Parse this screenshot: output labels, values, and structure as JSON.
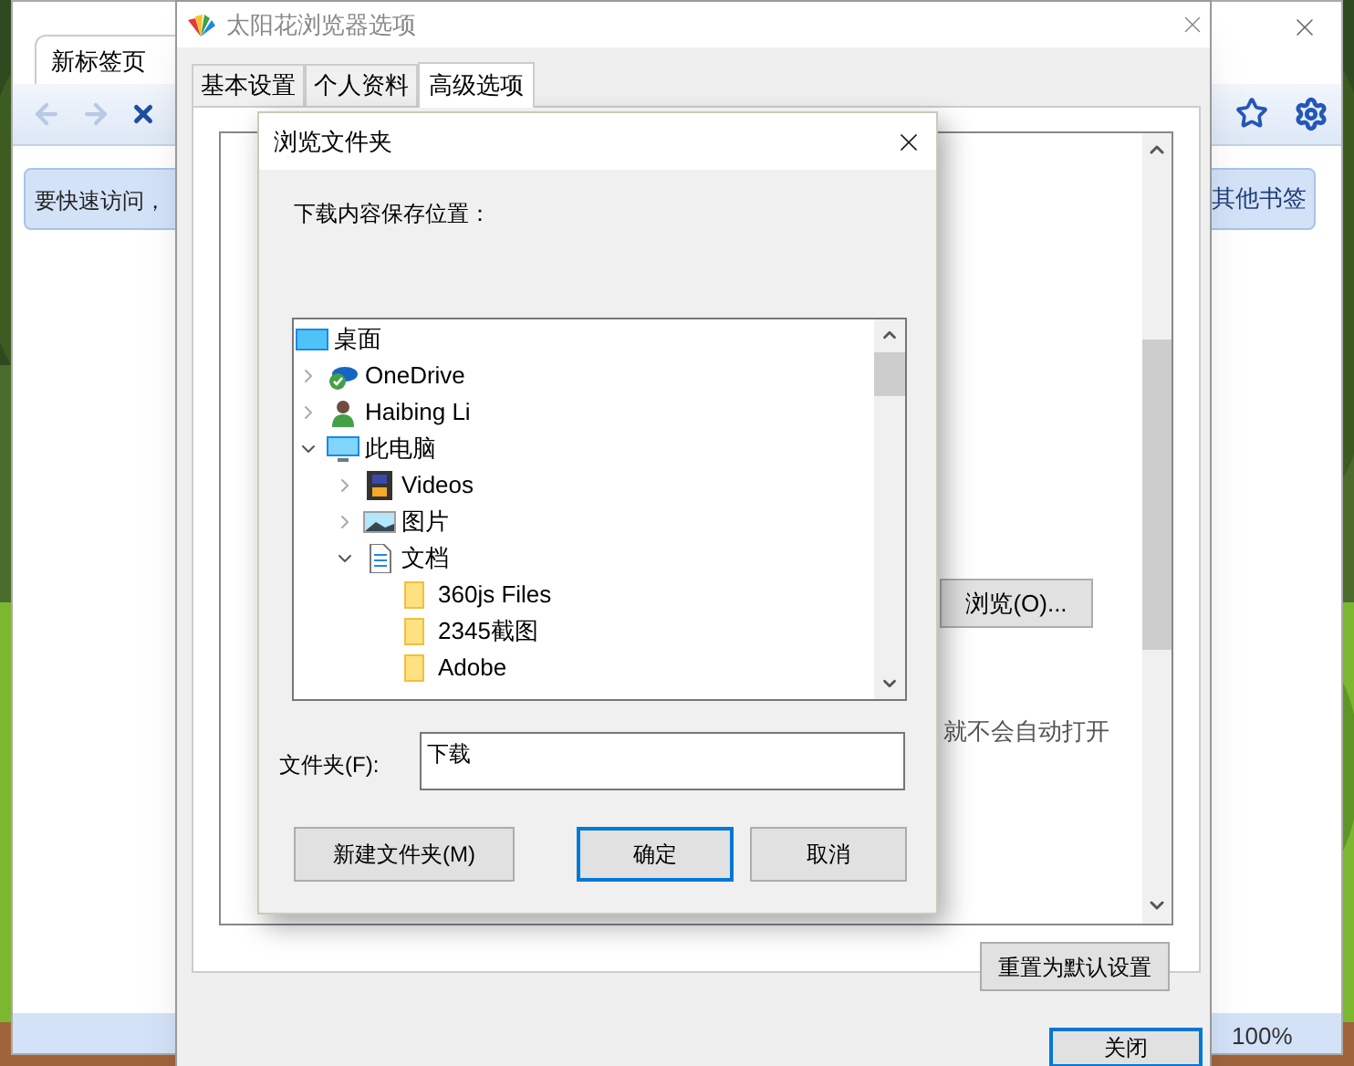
{
  "browser": {
    "tab": "新标签页",
    "bookmark_notice": "要快速访问，",
    "other_bookmarks": "其他书签",
    "zoom": "100%"
  },
  "options_dialog": {
    "title": "太阳花浏览器选项",
    "tabs": [
      {
        "label": "基本设置",
        "selected": false
      },
      {
        "label": "个人资料",
        "selected": false
      },
      {
        "label": "高级选项",
        "selected": true
      }
    ],
    "browse_button": "浏览(O)...",
    "partial_text": "就不会自动打开",
    "reset_button": "重置为默认设置",
    "close_button": "关闭"
  },
  "folder_dialog": {
    "title": "浏览文件夹",
    "prompt": "下载内容保存位置：",
    "tree": [
      {
        "label": "桌面",
        "kind": "desktop",
        "children": [
          {
            "label": "OneDrive",
            "kind": "cloud",
            "expanded": false
          },
          {
            "label": "Haibing Li",
            "kind": "user",
            "expanded": false
          },
          {
            "label": "此电脑",
            "kind": "computer",
            "expanded": true,
            "children": [
              {
                "label": "Videos",
                "kind": "video",
                "expanded": false
              },
              {
                "label": "图片",
                "kind": "pictures",
                "expanded": false
              },
              {
                "label": "文档",
                "kind": "document",
                "expanded": true,
                "children": [
                  {
                    "label": "360js Files",
                    "kind": "folder"
                  },
                  {
                    "label": "2345截图",
                    "kind": "folder"
                  },
                  {
                    "label": "Adobe",
                    "kind": "folder"
                  }
                ]
              }
            ]
          }
        ]
      }
    ],
    "folder_label": "文件夹(F):",
    "folder_value": "下载",
    "buttons": [
      {
        "label": "新建文件夹(M)",
        "kind": "secondary"
      },
      {
        "label": "确定",
        "kind": "default"
      },
      {
        "label": "取消",
        "kind": "secondary"
      }
    ]
  }
}
